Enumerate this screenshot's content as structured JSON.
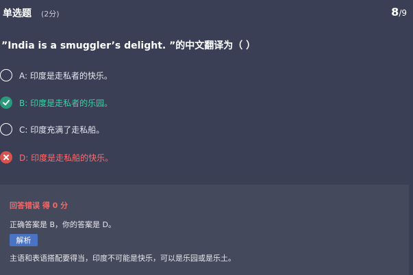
{
  "header": {
    "question_type": "单选题",
    "score": "(2分)",
    "progress_current": "8",
    "progress_total": "/9"
  },
  "question": {
    "text": "”India is a smuggler’s delight. ”的中文翻译为（  ）"
  },
  "options": [
    {
      "label": "A: 印度是走私者的快乐。",
      "state": "unselected"
    },
    {
      "label": "B: 印度是走私者的乐园。",
      "state": "correct"
    },
    {
      "label": "C: 印度充满了走私船。",
      "state": "unselected"
    },
    {
      "label": "D: 印度是走私船的快乐。",
      "state": "wrong"
    }
  ],
  "result": {
    "title": "回答错误 得 0 分",
    "answer_line": "正确答案是 B，你的答案是 D。",
    "analysis_button": "解析",
    "analysis_text": "主语和表语搭配要得当，印度不可能是快乐，可以是乐园或是乐土。"
  },
  "colors": {
    "background": "#3a3f56",
    "panel": "#45495c",
    "correct": "#2a9b7a",
    "correct_text": "#3fd0a6",
    "wrong": "#d9534f",
    "wrong_text": "#ff6b6b",
    "analysis_button": "#4a73c4"
  },
  "icons": {
    "correct": "check-circle-icon",
    "wrong": "x-circle-icon",
    "unselected": "radio-empty-icon"
  }
}
